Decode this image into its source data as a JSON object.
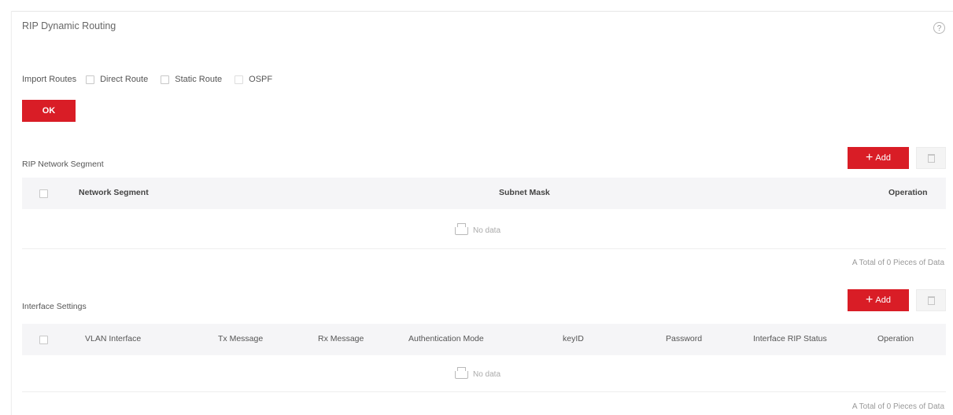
{
  "page": {
    "title": "RIP Dynamic Routing",
    "help_symbol": "?"
  },
  "import_routes": {
    "label": "Import Routes",
    "options": [
      {
        "label": "Direct Route",
        "checked": false
      },
      {
        "label": "Static Route",
        "checked": false
      },
      {
        "label": "OSPF",
        "checked": false
      }
    ],
    "ok_label": "OK"
  },
  "network_segment": {
    "title": "RIP Network Segment",
    "add_label": "Add",
    "columns": [
      "Network Segment",
      "Subnet Mask",
      "Operation"
    ],
    "empty_text": "No data",
    "total_text": "A Total of 0 Pieces of Data"
  },
  "interface_settings": {
    "title": "Interface Settings",
    "add_label": "Add",
    "columns": [
      "VLAN Interface",
      "Tx Message",
      "Rx Message",
      "Authentication Mode",
      "keyID",
      "Password",
      "Interface RIP Status",
      "Operation"
    ],
    "empty_text": "No data",
    "total_text": "A Total of 0 Pieces of Data"
  },
  "colors": {
    "accent": "#d91d26",
    "table_header_bg": "#f5f5f7",
    "divider": "#eeeeee"
  },
  "icons": {
    "help": "help-circle-icon",
    "delete": "trash-icon",
    "empty": "inbox-tray-icon",
    "add": "plus-icon"
  }
}
